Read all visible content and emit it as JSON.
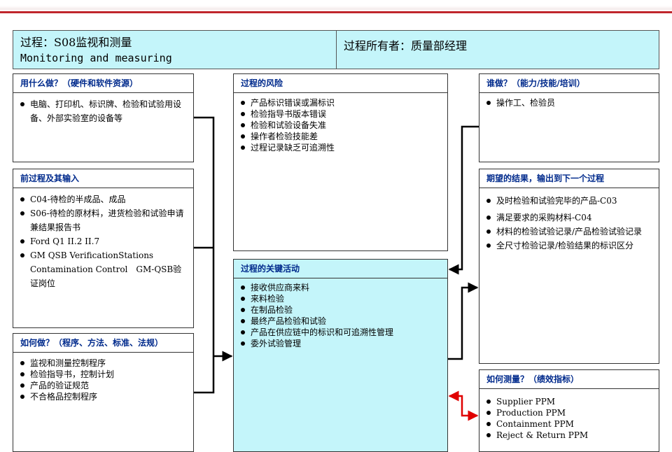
{
  "header": {
    "process_cn": "过程：S08监视和测量",
    "process_en": "Monitoring and measuring",
    "owner": "过程所有者：质量部经理"
  },
  "with_what": {
    "title": "用什么做？（硬件和软件资源）",
    "items": [
      "电脑、打印机、标识牌、检验和试验用设备、外部实验室的设备等"
    ]
  },
  "inputs": {
    "title": "前过程及其输入",
    "items": [
      "C04-待检的半成品、成品",
      "S06-待检的原材料，进货检验和试验申请兼结果报告书",
      "Ford Q1 II.2 II.7",
      "GM QSB VerificationStations Contamination Control　GM-QSB验证岗位"
    ]
  },
  "how": {
    "title": "如何做？（程序、方法、标准、法规）",
    "items": [
      "监视和测量控制程序",
      "检验指导书，控制计划",
      "产品的验证规范",
      "不合格品控制程序"
    ]
  },
  "risks": {
    "title": "过程的风险",
    "items": [
      "产品标识错误或漏标识",
      "检验指导书版本错误",
      "检验和试验设备失准",
      "操作者检验技能差",
      "过程记录缺乏可追溯性"
    ]
  },
  "activities": {
    "title": "过程的关键活动",
    "items": [
      "接收供应商来料",
      "来料检验",
      "在制品检验",
      "最终产品检验和试验",
      "产品在供应链中的标识和可追溯性管理",
      "委外试验管理"
    ]
  },
  "who": {
    "title": "谁做？（能力/技能/培训）",
    "items": [
      "操作工、检验员"
    ]
  },
  "outputs": {
    "title": "期望的结果，输出到下一个过程",
    "items": [
      "及时检验和试验完毕的产品-C03",
      "满足要求的采购材料-C04",
      "材料的检验试验记录/产品检验试验记录",
      "全尺寸检验记录/检验结果的标识区分"
    ]
  },
  "measure": {
    "title": "如何测量？（绩效指标）",
    "items": [
      "Supplier PPM",
      "Production PPM",
      "Containment PPM",
      "Reject & Return PPM"
    ]
  },
  "colors": {
    "header_bg": "#c4f5fa",
    "title_text": "#002a8c",
    "accent_red": "#c0262c",
    "arrow_red": "#e00000"
  }
}
